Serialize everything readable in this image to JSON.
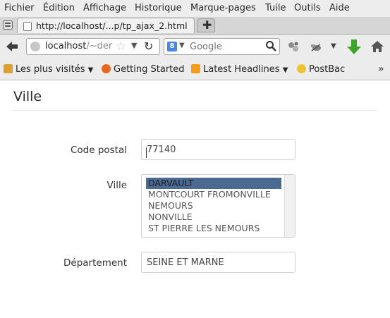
{
  "menubar": {
    "items": [
      "Fichier",
      "Édition",
      "Affichage",
      "Historique",
      "Marque-pages",
      "Tuile",
      "Outils",
      "Aide"
    ]
  },
  "tabs": [
    {
      "title": "http://localhost/...p/tp_ajax_2.html"
    }
  ],
  "newtab": {
    "label": "✚"
  },
  "urlbar": {
    "host": "localhost",
    "path": "/~der"
  },
  "search": {
    "engine_letter": "8",
    "placeholder": "Google"
  },
  "bookmarks": [
    {
      "label": "Les plus visités",
      "color": "#e0a030",
      "has_dropdown": true
    },
    {
      "label": "Getting Started",
      "color": "#e8671e",
      "has_dropdown": false
    },
    {
      "label": "Latest Headlines",
      "color": "#f39c1e",
      "has_dropdown": true
    },
    {
      "label": "PostBac",
      "color": "#f1c232",
      "has_dropdown": false
    }
  ],
  "page": {
    "title": "Ville",
    "postal": {
      "label": "Code postal",
      "value": "77140"
    },
    "ville": {
      "label": "Ville",
      "options": [
        "DARVAULT",
        "MONTCOURT FROMONVILLE",
        "NEMOURS",
        "NONVILLE",
        "ST PIERRE LES NEMOURS"
      ],
      "selected": "DARVAULT"
    },
    "departement": {
      "label": "Département",
      "value": "SEINE ET MARNE"
    }
  },
  "colors": {
    "selection": "#4b6a92",
    "toolbar": "#ececec",
    "download_arrow": "#3fa52a"
  },
  "icons": {
    "back": "back-arrow-icon",
    "reload": "reload-icon",
    "bookmark_star": "star-icon",
    "search": "magnifier-icon",
    "download": "download-arrow-icon",
    "home": "home-icon"
  }
}
